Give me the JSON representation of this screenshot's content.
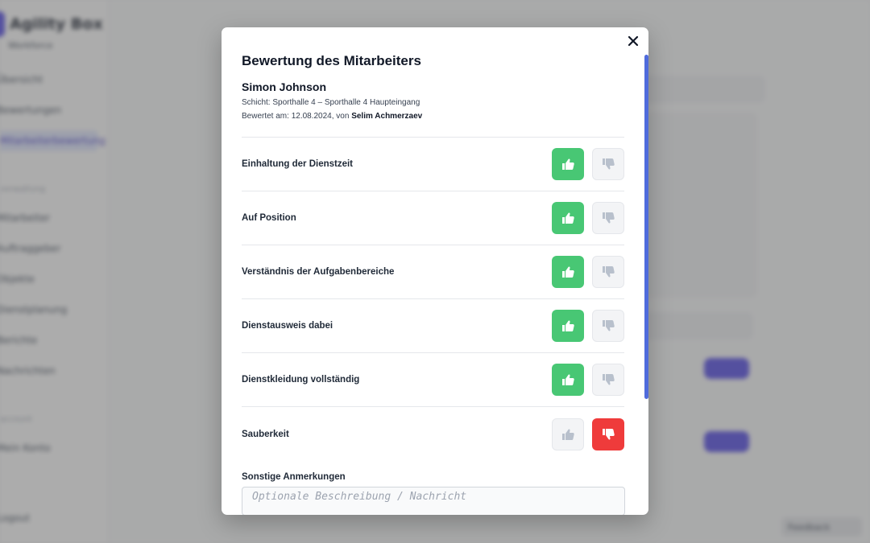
{
  "background": {
    "brand_name": "Agility Box",
    "brand_sub": "Workforce",
    "sidebar_items": [
      "Übersicht",
      "Bewertungen",
      "Mitarbeiterbewertung"
    ],
    "sidebar_section_1": "Verwaltung",
    "sidebar_items_2": [
      "Mitarbeiter",
      "Auftraggeber",
      "Objekte",
      "Dienstplanung",
      "Berichte",
      "Nachrichten"
    ],
    "sidebar_section_2": "Account",
    "sidebar_items_3": [
      "Mein Konto"
    ],
    "sidebar_bottom": "Logout",
    "chip_label": "Feedback"
  },
  "modal": {
    "title": "Bewertung des Mitarbeiters",
    "employee_name": "Simon Johnson",
    "shift": "Schicht: Sporthalle 4 – Sporthalle 4 Haupteingang",
    "rated_prefix": "Bewertet am: 12.08.2024, von ",
    "rated_by": "Selim Achmerzaev",
    "criteria": [
      {
        "label": "Einhaltung der Dienstzeit",
        "rating": "up"
      },
      {
        "label": "Auf Position",
        "rating": "up"
      },
      {
        "label": "Verständnis der Aufgabenbereiche",
        "rating": "up"
      },
      {
        "label": "Dienstausweis dabei",
        "rating": "up"
      },
      {
        "label": "Dienstkleidung vollständig",
        "rating": "up"
      },
      {
        "label": "Sauberkeit",
        "rating": "down"
      }
    ],
    "remarks_label": "Sonstige Anmerkungen",
    "remarks_placeholder": "Optionale Beschreibung / Nachricht",
    "remarks_value": ""
  },
  "icons": {
    "close": "close-icon",
    "thumbs_up": "thumbs-up-icon",
    "thumbs_down": "thumbs-down-icon"
  },
  "colors": {
    "approve": "#48c774",
    "reject": "#ef3b3b",
    "accent": "#4f6bdc",
    "inactive_icon": "#b8c0cc"
  }
}
